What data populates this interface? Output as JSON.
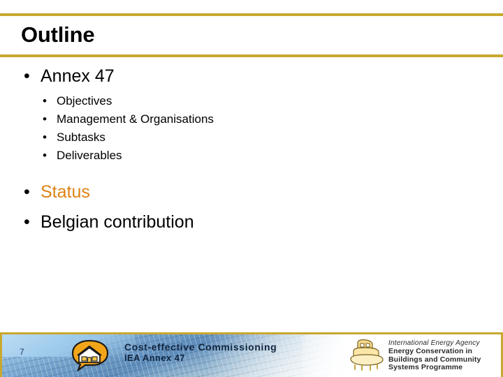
{
  "slide": {
    "title": "Outline",
    "accent_color": "#c8a82e",
    "highlight_color": "#e08214",
    "bullet_glyph": "•",
    "outline": [
      {
        "label": "Annex 47",
        "color": "#000000",
        "children": [
          {
            "label": "Objectives"
          },
          {
            "label": "Management & Organisations"
          },
          {
            "label": "Subtasks"
          },
          {
            "label": "Deliverables"
          }
        ]
      },
      {
        "label": "Status",
        "color": "#e08214",
        "children": []
      },
      {
        "label": "Belgian contribution",
        "color": "#000000",
        "children": []
      }
    ]
  },
  "footer": {
    "slide_number": "7",
    "project_line1": "Cost-effective Commissioning",
    "project_line2": "IEA Annex 47",
    "agency_italic": "International Energy Agency",
    "agency_line1": "Energy Conservation in",
    "agency_line2": "Buildings and Community",
    "agency_line3": "Systems Programme"
  }
}
